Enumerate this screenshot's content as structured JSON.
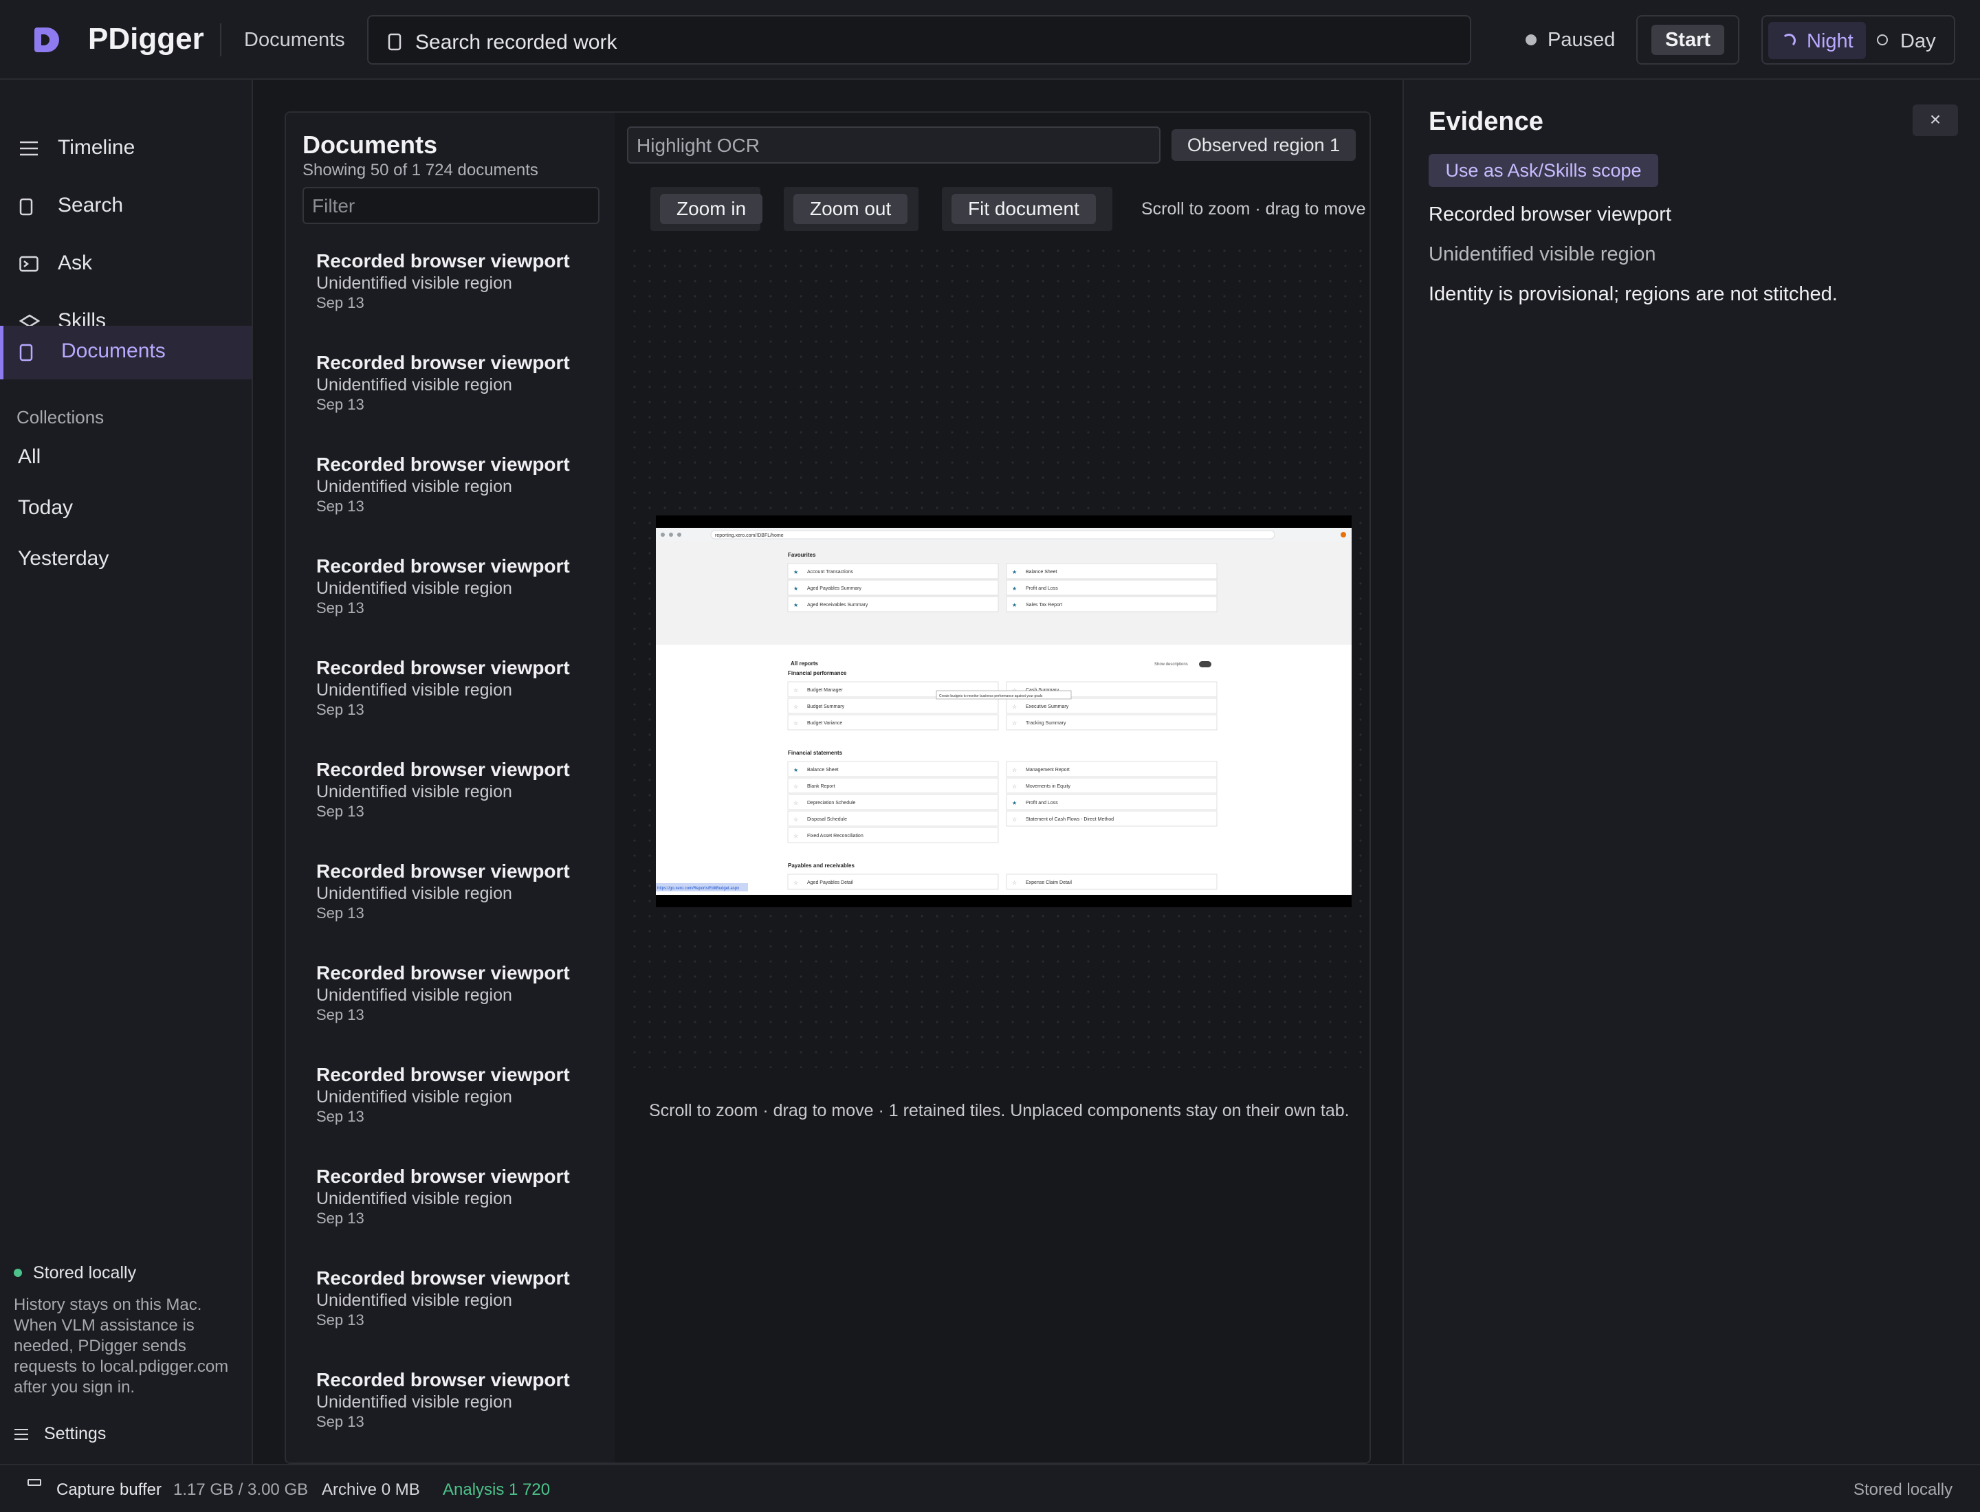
{
  "app": {
    "name": "PDigger",
    "section": "Documents"
  },
  "header": {
    "search_placeholder": "Search recorded work",
    "status": "Paused",
    "start_label": "Start",
    "theme_night": "Night",
    "theme_day": "Day"
  },
  "sidebar": {
    "nav": [
      {
        "label": "Timeline",
        "icon": "menu-icon"
      },
      {
        "label": "Search",
        "icon": "document-icon"
      },
      {
        "label": "Ask",
        "icon": "terminal-icon"
      },
      {
        "label": "Skills",
        "icon": "layers-icon"
      },
      {
        "label": "Documents",
        "icon": "document-icon",
        "active": true
      }
    ],
    "collections_title": "Collections",
    "collections": [
      "All",
      "Today",
      "Yesterday"
    ],
    "stored_title": "Stored locally",
    "stored_desc": "History stays on this Mac. When VLM assistance is needed, PDigger sends requests to local.pdigger.com after you sign in.",
    "settings_label": "Settings"
  },
  "documents": {
    "title": "Documents",
    "subtitle": "Showing 50 of 1 724 documents",
    "filter_placeholder": "Filter",
    "items": [
      {
        "title": "Recorded browser viewport",
        "subtitle": "Unidentified visible region",
        "date": "Sep 13"
      },
      {
        "title": "Recorded browser viewport",
        "subtitle": "Unidentified visible region",
        "date": "Sep 13"
      },
      {
        "title": "Recorded browser viewport",
        "subtitle": "Unidentified visible region",
        "date": "Sep 13"
      },
      {
        "title": "Recorded browser viewport",
        "subtitle": "Unidentified visible region",
        "date": "Sep 13"
      },
      {
        "title": "Recorded browser viewport",
        "subtitle": "Unidentified visible region",
        "date": "Sep 13"
      },
      {
        "title": "Recorded browser viewport",
        "subtitle": "Unidentified visible region",
        "date": "Sep 13"
      },
      {
        "title": "Recorded browser viewport",
        "subtitle": "Unidentified visible region",
        "date": "Sep 13"
      },
      {
        "title": "Recorded browser viewport",
        "subtitle": "Unidentified visible region",
        "date": "Sep 13"
      },
      {
        "title": "Recorded browser viewport",
        "subtitle": "Unidentified visible region",
        "date": "Sep 13"
      },
      {
        "title": "Recorded browser viewport",
        "subtitle": "Unidentified visible region",
        "date": "Sep 13"
      },
      {
        "title": "Recorded browser viewport",
        "subtitle": "Unidentified visible region",
        "date": "Sep 13"
      },
      {
        "title": "Recorded browser viewport",
        "subtitle": "Unidentified visible region",
        "date": "Sep 13"
      }
    ]
  },
  "viewer": {
    "ocr_placeholder": "Highlight OCR",
    "region_label": "Observed region 1",
    "zoom_in": "Zoom in",
    "zoom_out": "Zoom out",
    "fit": "Fit document",
    "hint": "Scroll to zoom · drag to move",
    "caption": "Scroll to zoom · drag to move · 1 retained tiles. Unplaced components stay on their own tab.",
    "tile": {
      "url": "reporting.xero.com/!DBFL/home",
      "favourites_title": "Favourites",
      "favourites_left": [
        "Account Transactions",
        "Aged Payables Summary",
        "Aged Receivables Summary"
      ],
      "favourites_right": [
        "Balance Sheet",
        "Profit and Loss",
        "Sales Tax Report"
      ],
      "all_reports": "All reports",
      "show_descriptions": "Show descriptions",
      "sections": [
        {
          "title": "Financial performance",
          "left": [
            "Budget Manager",
            "Budget Summary",
            "Budget Variance"
          ],
          "right": [
            "Cash Summary",
            "Executive Summary",
            "Tracking Summary"
          ]
        },
        {
          "title": "Financial statements",
          "left": [
            "Balance Sheet",
            "Blank Report",
            "Depreciation Schedule",
            "Disposal Schedule",
            "Fixed Asset Reconciliation"
          ],
          "right": [
            "Management Report",
            "Movements in Equity",
            "Profit and Loss",
            "Statement of Cash Flows - Direct Method"
          ]
        },
        {
          "title": "Payables and receivables",
          "left": [
            "Aged Payables Detail"
          ],
          "right": [
            "Expense Claim Detail"
          ]
        }
      ],
      "tooltip": "Create budgets to monitor business performance against your goals",
      "status_url": "https://go.xero.com/Reports/EditBudget.aspx"
    }
  },
  "evidence": {
    "title": "Evidence",
    "close": "×",
    "scope_button": "Use as Ask/Skills scope",
    "lines": [
      "Recorded browser viewport",
      "Unidentified visible region",
      "Identity is provisional; regions are not stitched."
    ]
  },
  "footer": {
    "capture_label": "Capture buffer",
    "capture_value": "1.17 GB / 3.00 GB",
    "archive": "Archive 0 MB",
    "analysis": "Analysis 1 720",
    "stored": "Stored locally"
  },
  "colors": {
    "accent": "#8f7bf0",
    "accent_text": "#b9a9ff",
    "success": "#4cc38a",
    "background": "#17181c"
  }
}
